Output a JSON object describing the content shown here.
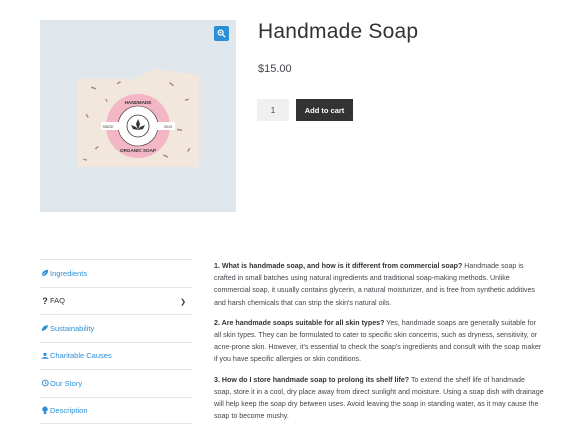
{
  "product": {
    "title": "Handmade Soap",
    "price": "$15.00",
    "quantity": "1",
    "add_to_cart": "Add to cart",
    "image_alt": "Handmade Soap bar",
    "label": {
      "top": "HANDMADE",
      "bottom": "ORGANIC SOAP",
      "left": "SINCE",
      "right": "2019"
    }
  },
  "tabs": [
    {
      "label": "Ingredients",
      "icon": "leaf-icon"
    },
    {
      "label": "FAQ",
      "icon": "question-icon"
    },
    {
      "label": "Sustainability",
      "icon": "recycle-icon"
    },
    {
      "label": "Charitable Causes",
      "icon": "charity-icon"
    },
    {
      "label": "Our Story",
      "icon": "history-icon"
    },
    {
      "label": "Description",
      "icon": "lightbulb-icon"
    }
  ],
  "faq": [
    {
      "q": "1. What is handmade soap, and how is it different from commercial soap?",
      "a": " Handmade soap is crafted in small batches using natural ingredients and traditional soap-making methods. Unlike commercial soap, it usually contains glycerin, a natural moisturizer, and is free from synthetic additives and harsh chemicals that can strip the skin's natural oils."
    },
    {
      "q": "2. Are handmade soaps suitable for all skin types?",
      "a": " Yes, handmade soaps are generally suitable for all skin types. They can be formulated to cater to specific skin concerns, such as dryness, sensitivity, or acne-prone skin. However, it's essential to check the soap's ingredients and consult with the soap maker if you have specific allergies or skin conditions."
    },
    {
      "q": "3. How do I store handmade soap to prolong its shelf life?",
      "a": " To extend the shelf life of handmade soap, store it in a cool, dry place away from direct sunlight and moisture. Using a soap dish with drainage will help keep the soap dry between uses. Avoid leaving the soap in standing water, as it may cause the soap to become mushy."
    }
  ],
  "colors": {
    "accent": "#2b8fd6",
    "button": "#333333",
    "gallery_bg": "#dfe6ec",
    "label_pink": "#f2b8c6"
  }
}
